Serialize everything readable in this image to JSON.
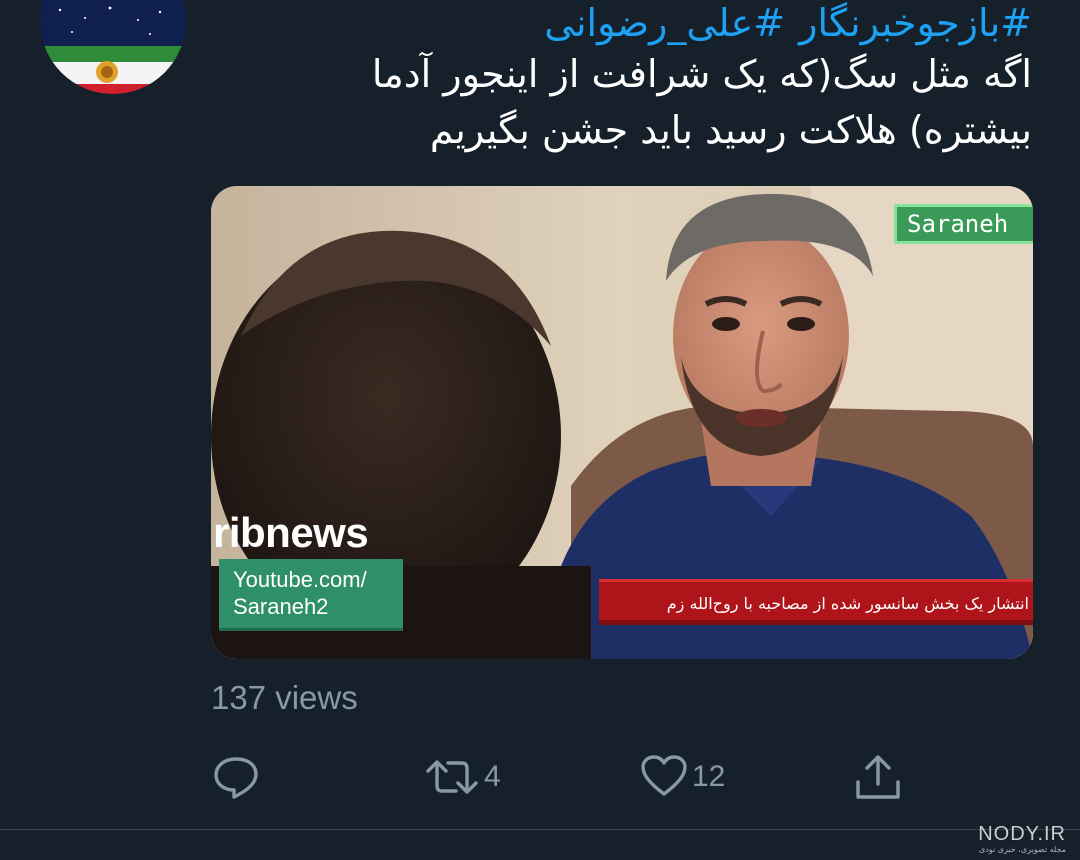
{
  "tweet": {
    "hashtags": [
      "#بازجوخبرنگار",
      "#علی_رضوانی"
    ],
    "text_lines": [
      "اگه مثل سگ(که یک شرافت از اینجور آدما",
      "بیشتره) هلاکت رسید باید جشن بگیریم"
    ]
  },
  "video": {
    "channel_tag": "Saraneh",
    "network_logo": "ribnews",
    "youtube_lines": [
      "Youtube.com/",
      "Saraneh2"
    ],
    "ticker": "انتشار یک بخش سانسور شده از مصاحبه با روح‌الله زم"
  },
  "views": "137 views",
  "actions": {
    "reply": {
      "icon": "reply-icon",
      "count": ""
    },
    "retweet": {
      "icon": "retweet-icon",
      "count": "4"
    },
    "like": {
      "icon": "heart-icon",
      "count": "12"
    },
    "share": {
      "icon": "share-icon",
      "count": ""
    }
  },
  "watermark": {
    "main": "NODY.IR",
    "sub": "مجله تصویری، خبری نودی"
  },
  "colors": {
    "background": "#15202b",
    "link": "#1da1f2",
    "muted": "#8899a6",
    "ticker_red": "#b0141b",
    "saraneh_green": "#3a9b58"
  }
}
